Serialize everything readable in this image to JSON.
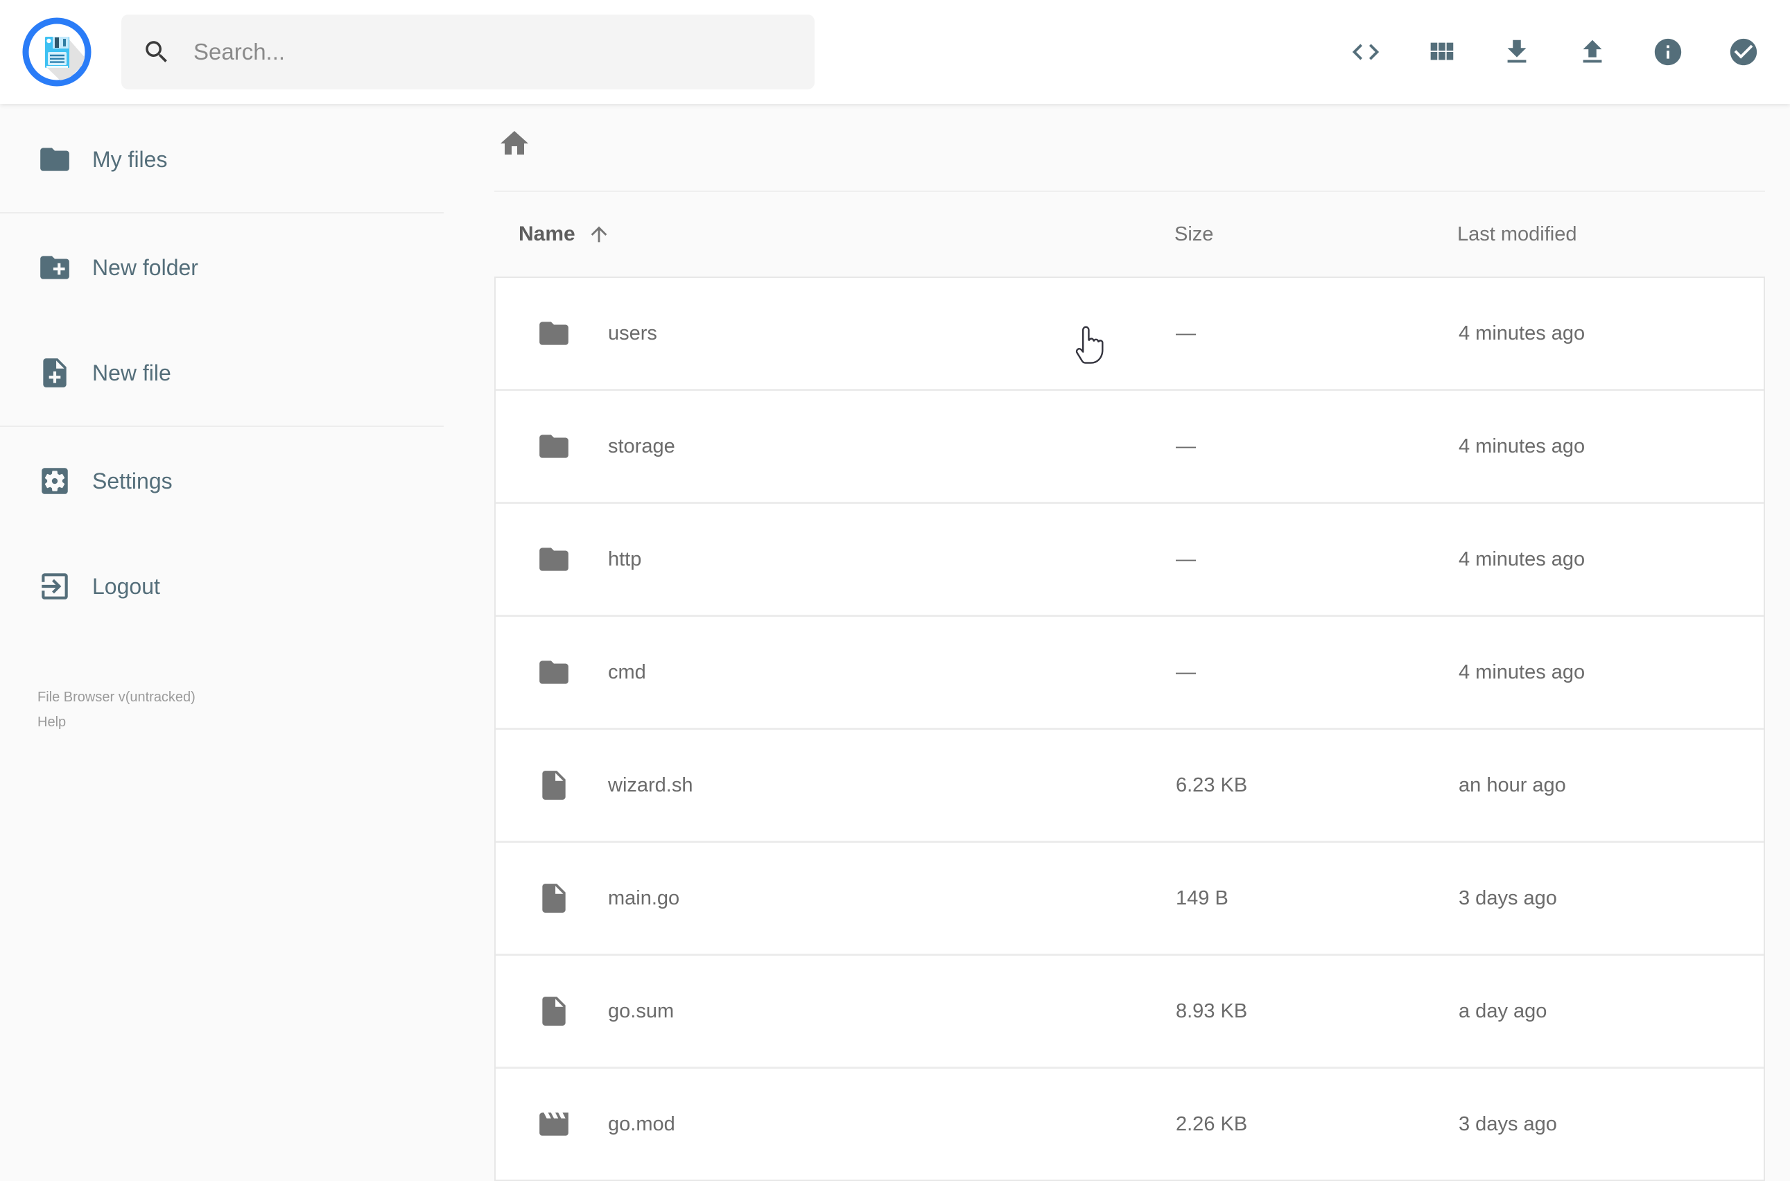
{
  "header": {
    "logo_icon": "floppy-disk-logo",
    "search": {
      "placeholder": "Search...",
      "icon": "search-icon"
    },
    "actions": [
      {
        "name": "shell",
        "icon": "code-icon"
      },
      {
        "name": "switch-view",
        "icon": "grid-view-icon"
      },
      {
        "name": "download",
        "icon": "download-icon"
      },
      {
        "name": "upload",
        "icon": "upload-icon"
      },
      {
        "name": "info",
        "icon": "info-icon"
      },
      {
        "name": "select-multiple",
        "icon": "check-circle-icon"
      }
    ]
  },
  "sidebar": {
    "items": [
      {
        "label": "My files",
        "icon": "folder-icon"
      },
      {
        "label": "New folder",
        "icon": "new-folder-icon"
      },
      {
        "label": "New file",
        "icon": "new-file-icon"
      },
      {
        "label": "Settings",
        "icon": "settings-icon"
      },
      {
        "label": "Logout",
        "icon": "logout-icon"
      }
    ],
    "footer": {
      "version": "File Browser v(untracked)",
      "help_label": "Help"
    }
  },
  "main": {
    "breadcrumb_icon": "home-icon",
    "columns": {
      "name": "Name",
      "size": "Size",
      "modified": "Last modified",
      "sort_icon": "sort-ascending-arrow-icon",
      "sort_order": "ascending"
    },
    "files": [
      {
        "name": "users",
        "icon": "folder-icon",
        "size": "—",
        "modified": "4 minutes ago"
      },
      {
        "name": "storage",
        "icon": "folder-icon",
        "size": "—",
        "modified": "4 minutes ago"
      },
      {
        "name": "http",
        "icon": "folder-icon",
        "size": "—",
        "modified": "4 minutes ago"
      },
      {
        "name": "cmd",
        "icon": "folder-icon",
        "size": "—",
        "modified": "4 minutes ago"
      },
      {
        "name": "wizard.sh",
        "icon": "file-icon",
        "size": "6.23 KB",
        "modified": "an hour ago"
      },
      {
        "name": "main.go",
        "icon": "file-icon",
        "size": "149 B",
        "modified": "3 days ago"
      },
      {
        "name": "go.sum",
        "icon": "file-icon",
        "size": "8.93 KB",
        "modified": "a day ago"
      },
      {
        "name": "go.mod",
        "icon": "movie-icon",
        "size": "2.26 KB",
        "modified": "3 days ago"
      }
    ]
  },
  "theme": {
    "accent_slate": "#546e7a",
    "icon_gray": "#757575",
    "text_gray": "#6b6b6b",
    "logo_ring_blue": "#2a7cf7",
    "logo_floppy_cyan": "#3ec1f3",
    "header_bg": "#ffffff",
    "body_bg": "#fafafa"
  }
}
